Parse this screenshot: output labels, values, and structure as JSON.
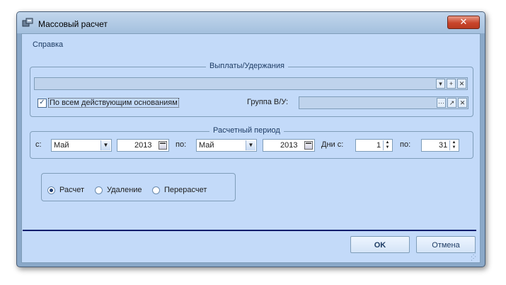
{
  "window": {
    "title": "Массовый расчет",
    "close_label": "✕"
  },
  "menu": {
    "items": [
      {
        "label": "Справка"
      }
    ]
  },
  "payments": {
    "legend": "Выплаты/Удержания",
    "all_grounds_label": "По всем действующим основаниям",
    "all_grounds_checked": true,
    "group_label": "Группа В/У:",
    "add_icon": "+",
    "clear_icon": "✕",
    "dots_icon": "···",
    "pin_icon": "pin-icon"
  },
  "period": {
    "legend": "Расчетный период",
    "from_label": "с:",
    "from_month": "Май",
    "from_year": "2013",
    "to_label": "по:",
    "to_month": "Май",
    "to_year": "2013",
    "days_from_label": "Дни с:",
    "days_from": "1",
    "days_to_label": "по:",
    "days_to": "31"
  },
  "mode": {
    "options": [
      {
        "label": "Расчет",
        "selected": true
      },
      {
        "label": "Удаление",
        "selected": false
      },
      {
        "label": "Перерасчет",
        "selected": false
      }
    ]
  },
  "buttons": {
    "ok_label": "OK",
    "cancel_label": "Отмена"
  },
  "colors": {
    "window_bg": "#c3daf9",
    "frame": "#8aa8c8",
    "separator": "#0b1e6e",
    "close": "#c8452c"
  }
}
